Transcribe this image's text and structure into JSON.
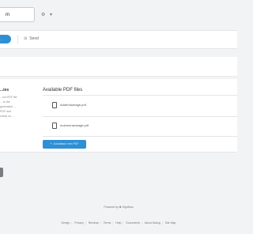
{
  "topbar": {
    "search_value": "m",
    "settings_icon": "gear-icon",
    "dropdown_icon": "chevron-down-icon"
  },
  "toolbar": {
    "primary_button_label": "...",
    "send_label": "Send",
    "send_icon": "send-icon"
  },
  "left": {
    "title": "...ies",
    "description": "...our PDF file ... to the generated ... PDF and check on ..."
  },
  "files_section": {
    "title": "Available PDF files",
    "files": [
      {
        "name": "Addendumagh.pdf",
        "icon": "file-icon"
      },
      {
        "name": "mobmnnwneaglr.pdf",
        "icon": "file-icon"
      }
    ],
    "add_button_label": "Add/attach new PDF",
    "add_icon": "plus-icon"
  },
  "footer": {
    "powered_by": "Powered by ✱ SignNow",
    "links": [
      "Design",
      "Privacy",
      "Reviews",
      "Terms",
      "Help",
      "Documents",
      "About Dialog",
      "Site Map"
    ]
  },
  "colors": {
    "accent": "#2f8fd4",
    "background": "#f2f3f4",
    "panel": "#ffffff"
  }
}
